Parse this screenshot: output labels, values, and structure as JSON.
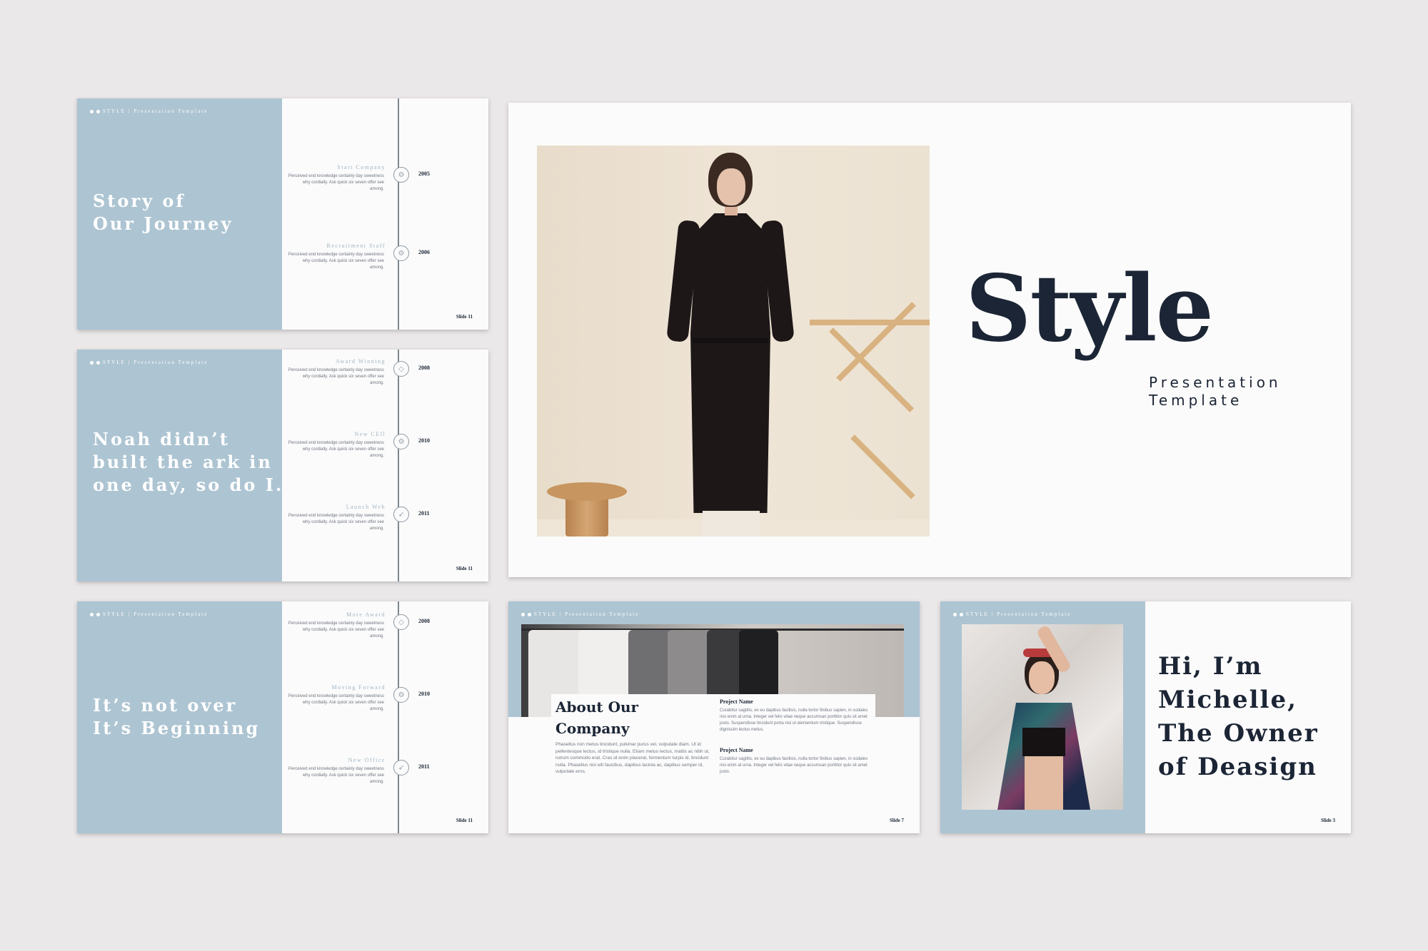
{
  "brand": {
    "name": "STYLE",
    "subtitle": "Presentation Template"
  },
  "slides": {
    "journey": {
      "title_line1": "Story of",
      "title_line2": "Our Journey",
      "slide_number": "Slide 11",
      "entries": [
        {
          "heading": "Start Company",
          "year": "2005",
          "icon": "gear-icon",
          "text": "Perceived end knowledge certainly day sweetness why cordially. Ask quick six seven offer see among."
        },
        {
          "heading": "Recruitment Staff",
          "year": "2006",
          "icon": "gear-icon",
          "text": "Perceived end knowledge certainly day sweetness why cordially. Ask quick six seven offer see among."
        }
      ]
    },
    "noah": {
      "title_line1": "Noah didn’t",
      "title_line2": "built the ark in",
      "title_line3": "one day, so do I.",
      "slide_number": "Slide 11",
      "entries": [
        {
          "heading": "Award Winning",
          "year": "2008",
          "icon": "diamond-icon",
          "text": "Perceived end knowledge certainly day sweetness why cordially. Ask quick six seven offer see among."
        },
        {
          "heading": "New CEO",
          "year": "2010",
          "icon": "gear-icon",
          "text": "Perceived end knowledge certainly day sweetness why cordially. Ask quick six seven offer see among."
        },
        {
          "heading": "Launch Web",
          "year": "2011",
          "icon": "rocket-icon",
          "text": "Perceived end knowledge certainly day sweetness why cordially. Ask quick six seven offer see among."
        }
      ]
    },
    "beginning": {
      "title_line1": "It’s not over",
      "title_line2": "It’s Beginning",
      "slide_number": "Slide 11",
      "entries": [
        {
          "heading": "More Award",
          "year": "2008",
          "icon": "diamond-icon",
          "text": "Perceived end knowledge certainly day sweetness why cordially. Ask quick six seven offer see among."
        },
        {
          "heading": "Moving Forward",
          "year": "2010",
          "icon": "gear-icon",
          "text": "Perceived end knowledge certainly day sweetness why cordially. Ask quick six seven offer see among."
        },
        {
          "heading": "New Office",
          "year": "2011",
          "icon": "rocket-icon",
          "text": "Perceived end knowledge certainly day sweetness why cordially. Ask quick six seven offer see among."
        }
      ]
    },
    "cover": {
      "title": "Style",
      "subtitle_line1": "Presentation",
      "subtitle_line2": "Template"
    },
    "about": {
      "title_line1": "About Our",
      "title_line2": "Company",
      "body": "Phasellus non metus tincidunt, pulvinar purus vel, vulputate diam. Ut id pellentesque lectus, id tristique nulla. Etiam metus lectus, mattis ac nibh ut, rutrum commodo erat. Cras id enim placerat, fermentum turpis id, tincidunt nulla. Phasellus nisi elit faucibus, dapibus lacinia ac, dapibus semper id, vulputate eros.",
      "slide_number": "Slide 7",
      "projects": [
        {
          "name": "Project Name",
          "text": "Curabitur sagittis, ex eu dapibus facilisis, nulla tortor finibus sapien, in sodales nisi enim at urna. Integer vel felis vitae neque accumsan porttitor quis sit amet justo. Suspendisse tincidunt porta nisi ut elementum tristique. Suspendisse dignissim lectus metus."
        },
        {
          "name": "Project Name",
          "text": "Curabitur sagittis, ex eu dapibus facilisis, nulla tortor finibus sapien, in sodales nisi enim at urna. Integer vel felis vitae neque accumsan porttitor quis sit amet justo."
        }
      ]
    },
    "michelle": {
      "title_line1": "Hi, I’m",
      "title_line2": "Michelle,",
      "title_line3": "The Owner",
      "title_line4": "of Deasign",
      "slide_number": "Slide 3"
    }
  },
  "colors": {
    "accent": "#adc4d2",
    "navy": "#1b2535",
    "background": "#ebe8e9",
    "slide": "#fbfbfb"
  }
}
